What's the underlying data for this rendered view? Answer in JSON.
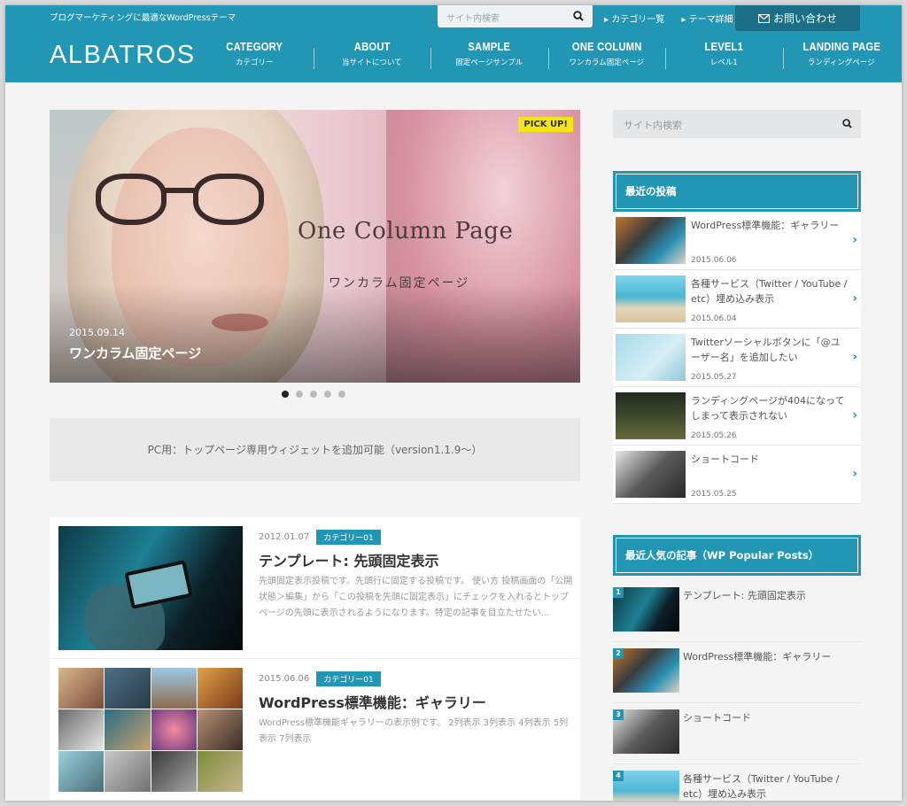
{
  "header": {
    "tagline": "ブログマーケティングに最適なWordPressテーマ",
    "search_placeholder": "サイト内検索",
    "top_links": [
      "カテゴリ一覧",
      "テーマ詳細"
    ],
    "contact_label": "お問い合わせ",
    "logo": "ALBATROS",
    "nav": [
      {
        "en": "CATEGORY",
        "jp": "カテゴリー"
      },
      {
        "en": "ABOUT",
        "jp": "当サイトについて"
      },
      {
        "en": "SAMPLE",
        "jp": "固定ページサンプル"
      },
      {
        "en": "ONE COLUMN",
        "jp": "ワンカラム固定ページ"
      },
      {
        "en": "LEVEL1",
        "jp": "レベル1"
      },
      {
        "en": "LANDING PAGE",
        "jp": "ランディングページ"
      }
    ],
    "colors": {
      "brand": "#2296b5",
      "contact": "#1a6e86"
    }
  },
  "slider": {
    "badge": "PICK UP!",
    "image_title": "One Column Page",
    "image_subtitle": "ワンカラム固定ページ",
    "date": "2015.09.14",
    "caption": "ワンカラム固定ページ",
    "dot_count": 5,
    "active_dot": 1
  },
  "notice": "PC用：トップページ専用ウィジェットを追加可能（version1.1.9〜）",
  "posts": [
    {
      "date": "2012.01.07",
      "category": "カテゴリー01",
      "title": "テンプレート: 先頭固定表示",
      "excerpt": "先頭固定表示投稿です。先頭行に固定する投稿です。 使い方 投稿画面の「公開状態＞編集」から「この投稿を先頭に固定表示」にチェックを入れるとトップページの先頭に表示されるようになります。特定の記事を目立たせたい..."
    },
    {
      "date": "2015.06.06",
      "category": "カテゴリー01",
      "title": "WordPress標準機能：ギャラリー",
      "excerpt": "WordPress標準機能ギャラリーの表示例です。 2列表示 3列表示 4列表示 5列表示 7列表示"
    }
  ],
  "sidebar": {
    "search_placeholder": "サイト内検索",
    "recent_title": "最近の投稿",
    "recent": [
      {
        "title": "WordPress標準機能：ギャラリー",
        "date": "2015.06.06"
      },
      {
        "title": "各種サービス（Twitter / YouTube / etc）埋め込み表示",
        "date": "2015.06.04"
      },
      {
        "title": "Twitterソーシャルボタンに「@ユーザー名」を追加したい",
        "date": "2015.05.27"
      },
      {
        "title": "ランディングページが404になってしまって表示されない",
        "date": "2015.05.26"
      },
      {
        "title": "ショートコード",
        "date": "2015.05.25"
      }
    ],
    "popular_title": "最近人気の記事（WP Popular Posts）",
    "popular": [
      {
        "rank": "1",
        "title": "テンプレート: 先頭固定表示"
      },
      {
        "rank": "2",
        "title": "WordPress標準機能：ギャラリー"
      },
      {
        "rank": "3",
        "title": "ショートコード"
      },
      {
        "rank": "4",
        "title": "各種サービス（Twitter / YouTube / etc）埋め込み表示"
      }
    ]
  }
}
